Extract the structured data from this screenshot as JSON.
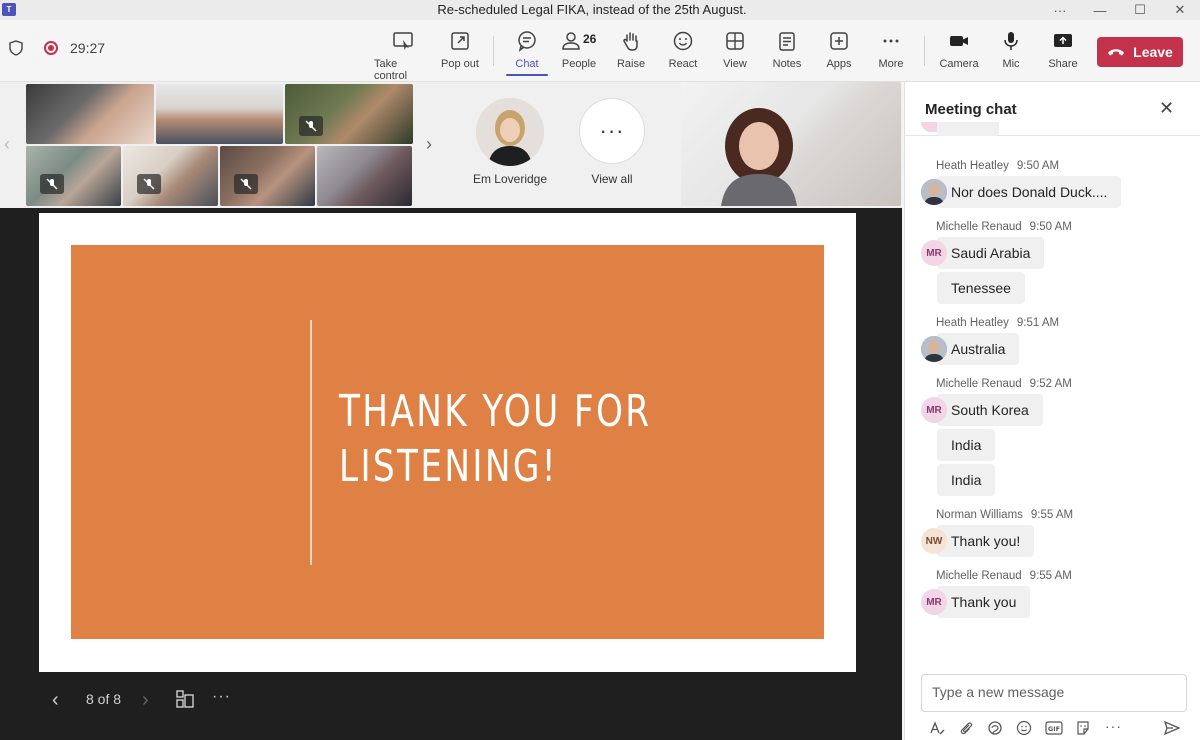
{
  "window": {
    "title": "Re-scheduled Legal FIKA, instead of the 25th August.",
    "controls": [
      "···",
      "—",
      "☐",
      "✕"
    ]
  },
  "toolbar": {
    "timer": "29:27",
    "buttons": {
      "take_control": "Take control",
      "pop_out": "Pop out",
      "chat": "Chat",
      "people": "People",
      "people_count": "26",
      "raise": "Raise",
      "react": "React",
      "view": "View",
      "notes": "Notes",
      "apps": "Apps",
      "more": "More",
      "camera": "Camera",
      "mic": "Mic",
      "share": "Share",
      "leave": "Leave"
    },
    "accent": "#4b53bc",
    "leave_color": "#c4314b"
  },
  "gallery": {
    "featured_name": "Em Loveridge",
    "view_all": "View all",
    "view_all_glyph": "···"
  },
  "slide": {
    "title": "THANK YOU FOR\nLISTENING!",
    "page_indicator": "8 of 8",
    "background_color": "#df8145"
  },
  "chat": {
    "header": "Meeting chat",
    "messages": [
      {
        "author": "Heath Heatley",
        "time": "9:50 AM",
        "initials": "",
        "texts": [
          "Nor does Donald Duck...."
        ]
      },
      {
        "author": "Michelle Renaud",
        "time": "9:50 AM",
        "initials": "MR",
        "texts": [
          "Saudi Arabia",
          "Tenessee"
        ]
      },
      {
        "author": "Heath Heatley",
        "time": "9:51 AM",
        "initials": "",
        "texts": [
          "Australia"
        ]
      },
      {
        "author": "Michelle Renaud",
        "time": "9:52 AM",
        "initials": "MR",
        "texts": [
          "South Korea",
          "India",
          "India"
        ]
      },
      {
        "author": "Norman Williams",
        "time": "9:55 AM",
        "initials": "NW",
        "texts": [
          "Thank you!"
        ]
      },
      {
        "author": "Michelle Renaud",
        "time": "9:55 AM",
        "initials": "MR",
        "texts": [
          "Thank you"
        ]
      }
    ],
    "composer_placeholder": "Type a new message"
  }
}
